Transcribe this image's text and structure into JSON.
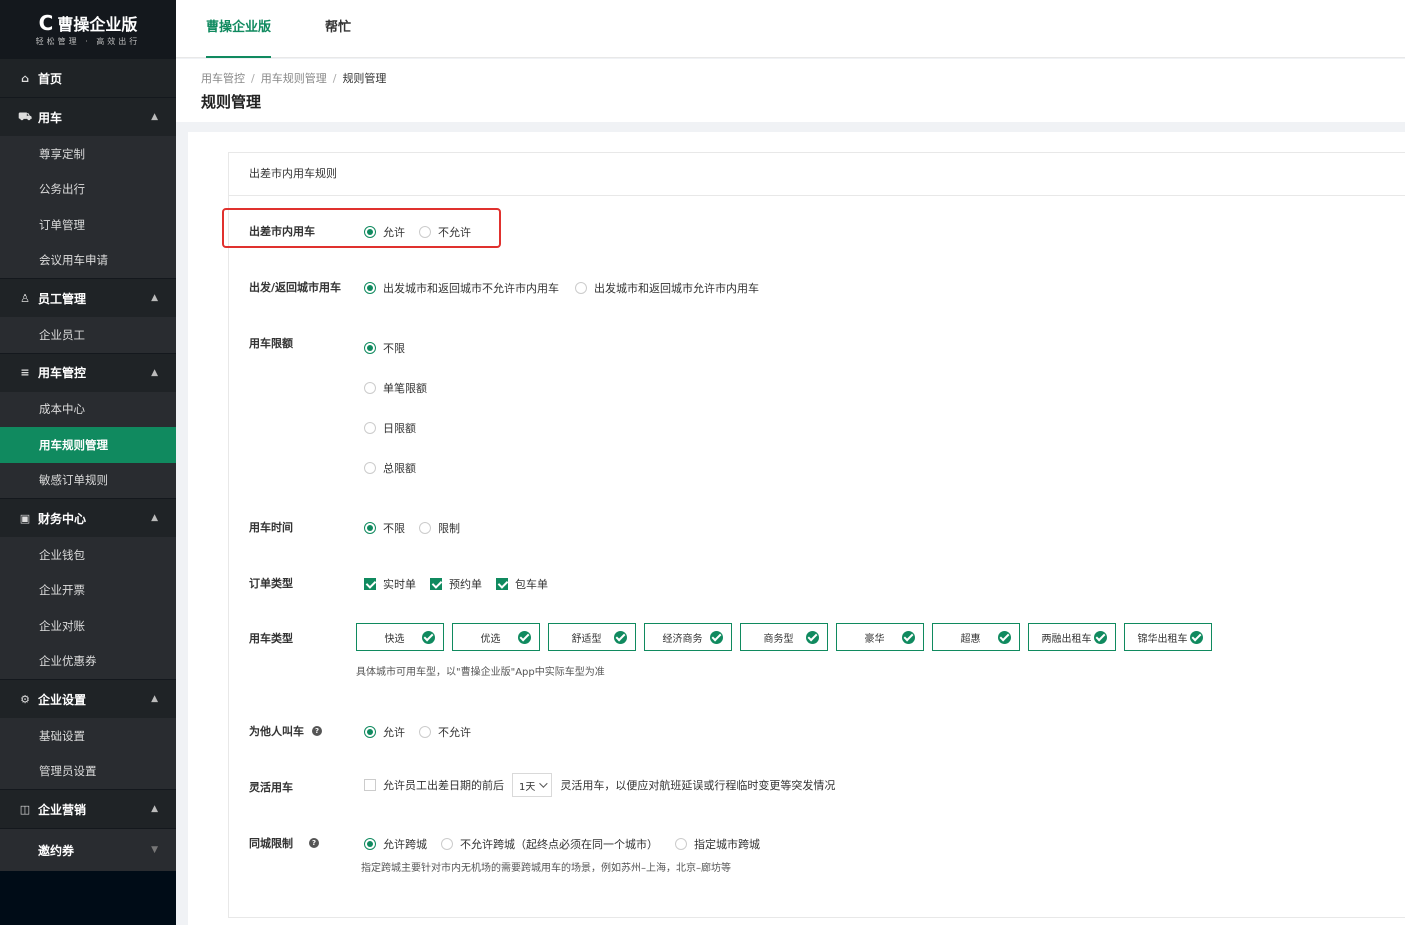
{
  "brand": {
    "logo_letter": "C",
    "name": "曹操企业版",
    "slogan": "轻松管理 · 高效出行"
  },
  "sidebar": {
    "home": "首页",
    "groups": [
      {
        "label": "用车",
        "icon": "car-icon",
        "items": [
          "尊享定制",
          "公务出行",
          "订单管理",
          "会议用车申请"
        ]
      },
      {
        "label": "员工管理",
        "icon": "user-icon",
        "items": [
          "企业员工"
        ]
      },
      {
        "label": "用车管控",
        "icon": "sliders-icon",
        "items": [
          "成本中心",
          "用车规则管理",
          "敏感订单规则"
        ],
        "active_item": "用车规则管理"
      },
      {
        "label": "财务中心",
        "icon": "finance-icon",
        "items": [
          "企业钱包",
          "企业开票",
          "企业对账",
          "企业优惠券"
        ]
      },
      {
        "label": "企业设置",
        "icon": "gear-icon",
        "items": [
          "基础设置",
          "管理员设置"
        ]
      },
      {
        "label": "企业营销",
        "icon": "marketing-icon",
        "items": []
      }
    ],
    "last_item": "邀约券"
  },
  "topbar": {
    "tabs": [
      "曹操企业版",
      "帮忙"
    ],
    "active_tab": "曹操企业版"
  },
  "breadcrumb": [
    "用车管控",
    "用车规则管理",
    "规则管理"
  ],
  "page_title": "规则管理",
  "card_title": "出差市内用车规则",
  "form": {
    "city_use": {
      "label": "出差市内用车",
      "options": [
        "允许",
        "不允许"
      ],
      "selected": "允许"
    },
    "depart_return": {
      "label": "出发/返回城市用车",
      "options": [
        "出发城市和返回城市不允许市内用车",
        "出发城市和返回城市允许市内用车"
      ],
      "selected": "出发城市和返回城市不允许市内用车"
    },
    "limit": {
      "label": "用车限额",
      "options": [
        "不限",
        "单笔限额",
        "日限额",
        "总限额"
      ],
      "selected": "不限"
    },
    "time": {
      "label": "用车时间",
      "options": [
        "不限",
        "限制"
      ],
      "selected": "不限"
    },
    "order_type": {
      "label": "订单类型",
      "options": [
        "实时单",
        "预约单",
        "包车单"
      ]
    },
    "car_type": {
      "label": "用车类型",
      "options": [
        "快选",
        "优选",
        "舒适型",
        "经济商务",
        "商务型",
        "豪华",
        "超惠",
        "两融出租车",
        "锦华出租车"
      ],
      "note": "具体城市可用车型，以\"曹操企业版\"App中实际车型为准"
    },
    "call_for_others": {
      "label": "为他人叫车",
      "options": [
        "允许",
        "不允许"
      ],
      "selected": "允许"
    },
    "flexible": {
      "label": "灵活用车",
      "prefix": "允许员工出差日期的前后",
      "select_value": "1天",
      "suffix": "灵活用车，以便应对航班延误或行程临时变更等突发情况"
    },
    "same_city": {
      "label": "同城限制",
      "options": [
        "允许跨城",
        "不允许跨城（起终点必须在同一个城市）",
        "指定城市跨城"
      ],
      "selected": "允许跨城",
      "note": "指定跨城主要针对市内无机场的需要跨城用车的场景，例如苏州–上海，北京–廊坊等"
    }
  },
  "colors": {
    "accent": "#108a5f",
    "sidebar_bg": "#000c17",
    "highlight": "#e0312e"
  }
}
